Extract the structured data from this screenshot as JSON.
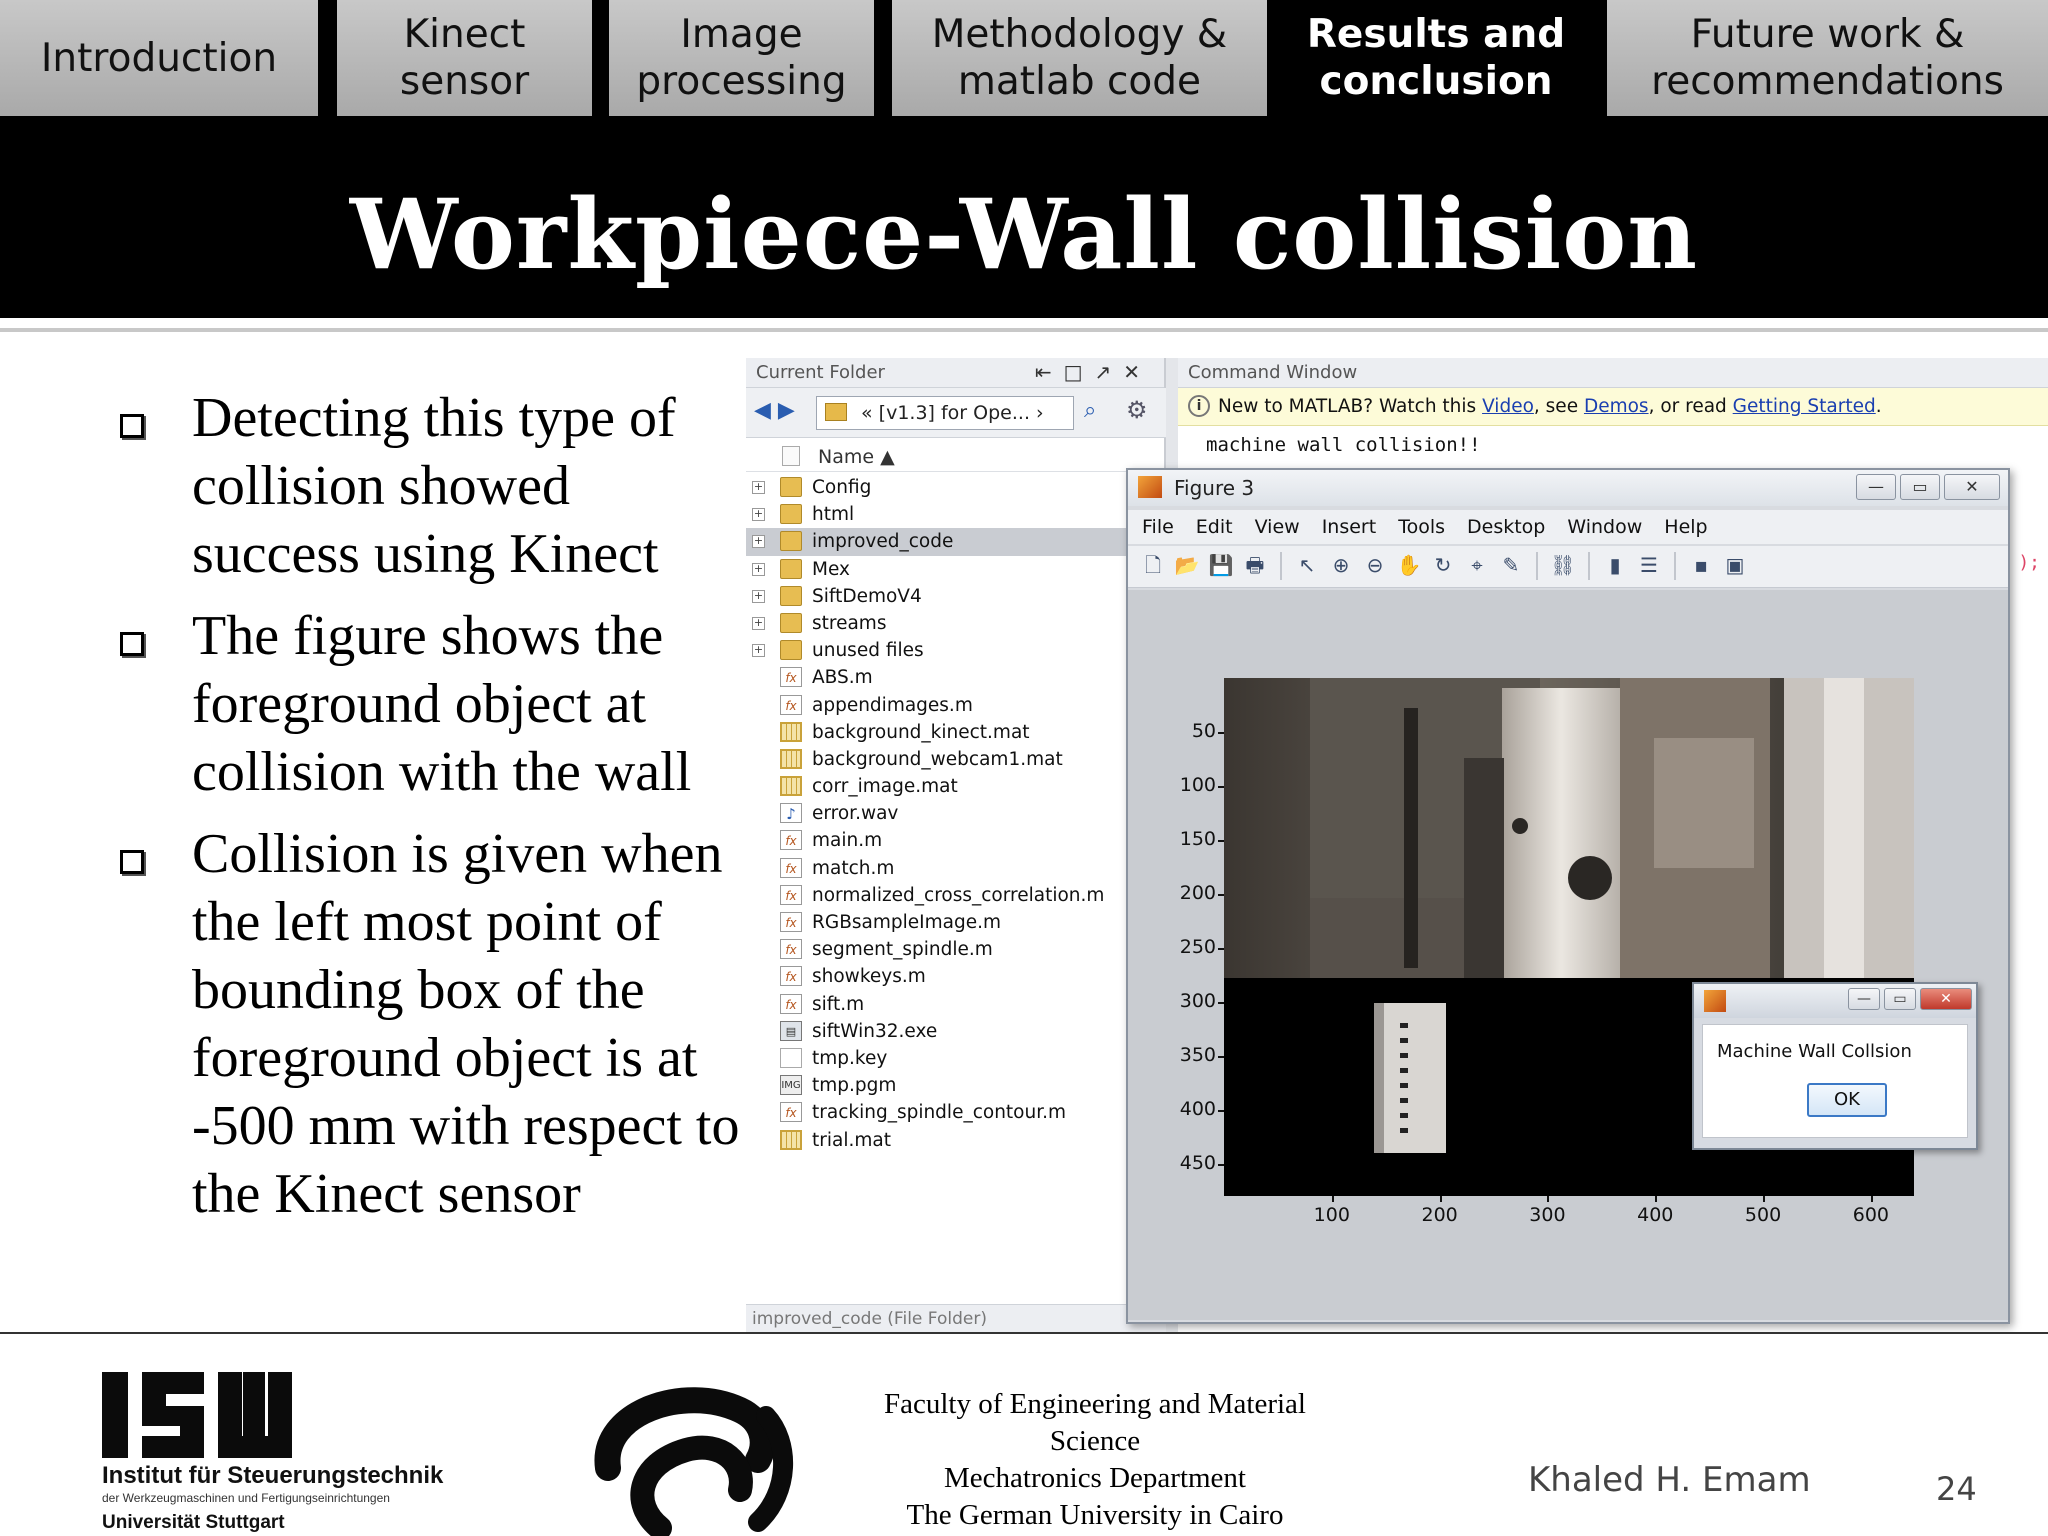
{
  "nav": {
    "tabs": [
      {
        "label": "Introduction"
      },
      {
        "label": "Kinect\nsensor"
      },
      {
        "label": "Image\nprocessing"
      },
      {
        "label": "Methodology &\nmatlab code"
      },
      {
        "label": "Results and\nconclusion"
      },
      {
        "label": "Future work &\nrecommendations"
      }
    ],
    "active_label": "Results and conclusion"
  },
  "slide": {
    "title": "Workpiece-Wall collision",
    "bullets": [
      "Detecting this type of collision showed success using Kinect",
      "The figure shows the foreground object at collision with the wall",
      "Collision is given when the left most point of bounding box of the foreground object is at -500 mm with respect to the Kinect sensor"
    ]
  },
  "matlab": {
    "current_folder": {
      "header": "Current Folder",
      "path": "« [v1.3] for Ope... ›",
      "column": "Name ▲",
      "items": [
        {
          "name": "Config",
          "type": "folder"
        },
        {
          "name": "html",
          "type": "folder"
        },
        {
          "name": "improved_code",
          "type": "folder",
          "selected": true
        },
        {
          "name": "Mex",
          "type": "folder"
        },
        {
          "name": "SiftDemoV4",
          "type": "folder"
        },
        {
          "name": "streams",
          "type": "folder"
        },
        {
          "name": "unused files",
          "type": "folder"
        },
        {
          "name": "ABS.m",
          "type": "mfile"
        },
        {
          "name": "appendimages.m",
          "type": "mfile"
        },
        {
          "name": "background_kinect.mat",
          "type": "mat"
        },
        {
          "name": "background_webcam1.mat",
          "type": "mat"
        },
        {
          "name": "corr_image.mat",
          "type": "mat"
        },
        {
          "name": "error.wav",
          "type": "wav"
        },
        {
          "name": "main.m",
          "type": "mfile"
        },
        {
          "name": "match.m",
          "type": "mfile"
        },
        {
          "name": "normalized_cross_correlation.m",
          "type": "mfile"
        },
        {
          "name": "RGBsampleImage.m",
          "type": "mfile"
        },
        {
          "name": "segment_spindle.m",
          "type": "mfile"
        },
        {
          "name": "showkeys.m",
          "type": "mfile"
        },
        {
          "name": "sift.m",
          "type": "mfile"
        },
        {
          "name": "siftWin32.exe",
          "type": "exe"
        },
        {
          "name": "tmp.key",
          "type": "blank"
        },
        {
          "name": "tmp.pgm",
          "type": "pgm"
        },
        {
          "name": "tracking_spindle_contour.m",
          "type": "mfile"
        },
        {
          "name": "trial.mat",
          "type": "mat"
        }
      ],
      "status": "improved_code (File Folder)"
    },
    "command_window": {
      "header": "Command Window",
      "info_prefix": "New to MATLAB? Watch this ",
      "link_video": "Video",
      "info_mid1": ", see ",
      "link_demos": "Demos",
      "info_mid2": ", or read ",
      "link_started": "Getting Started",
      "info_end": ".",
      "output": "machine wall collision!!",
      "tail": ");"
    },
    "figure": {
      "title": "Figure 3",
      "menu": [
        "File",
        "Edit",
        "View",
        "Insert",
        "Tools",
        "Desktop",
        "Window",
        "Help"
      ],
      "tools": [
        "new-icon",
        "open-icon",
        "save-icon",
        "print-icon",
        "pointer-icon",
        "zoom-in-icon",
        "zoom-out-icon",
        "pan-icon",
        "rotate-icon",
        "datacursor-icon",
        "brush-icon",
        "link-icon",
        "colorbar-icon",
        "legend-icon",
        "hide-icon",
        "show-icon"
      ],
      "yticks": [
        "50",
        "100",
        "150",
        "200",
        "250",
        "300",
        "350",
        "400",
        "450"
      ],
      "xticks": [
        "100",
        "200",
        "300",
        "400",
        "500",
        "600"
      ]
    },
    "dialog": {
      "message": "Machine Wall Collsion",
      "ok_label": "OK"
    }
  },
  "footer": {
    "isw_logo_text": "ISW",
    "isw_name": "Institut für Steuerungstechnik",
    "isw_sub": "der Werkzeugmaschinen und Fertigungseinrichtungen",
    "isw_uni": "Universität Stuttgart",
    "faculty_lines": [
      "Faculty of Engineering and Material",
      "Science",
      "Mechatronics Department",
      "The German University in Cairo"
    ],
    "author": "Khaled H. Emam",
    "page": "24"
  },
  "colors": {
    "nav_inactive": "#b8b8b8",
    "nav_active": "#000000",
    "title_band": "#000000",
    "info_bar": "#fdfbd8",
    "link": "#1a3fb0"
  }
}
